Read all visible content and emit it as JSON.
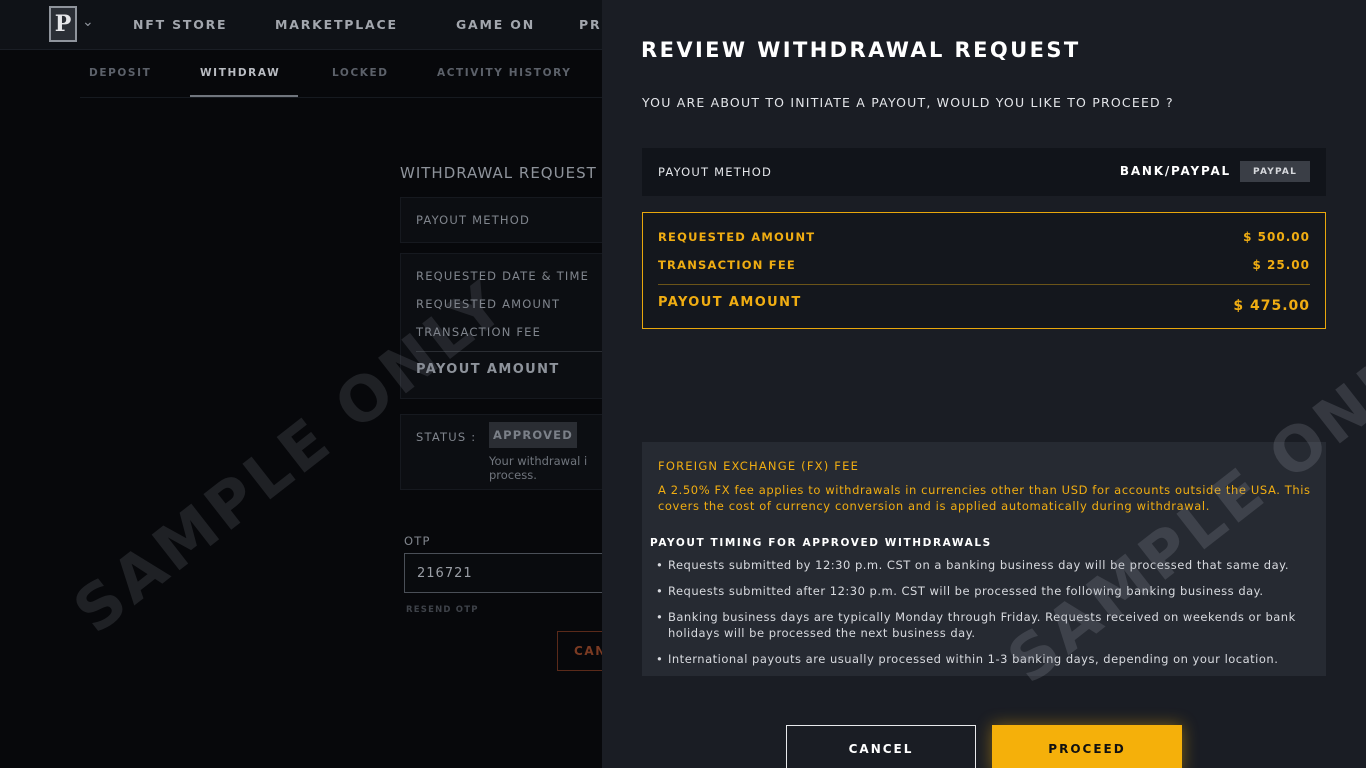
{
  "nav": {
    "items": [
      "NFT STORE",
      "MARKETPLACE",
      "GAME ON",
      "PR"
    ],
    "logo_letter": "P"
  },
  "tabs": [
    "DEPOSIT",
    "WITHDRAW",
    "LOCKED",
    "ACTIVITY HISTORY"
  ],
  "background_form": {
    "title": "WITHDRAWAL REQUEST",
    "payout_method_label": "PAYOUT METHOD",
    "requested_date_label": "REQUESTED DATE & TIME",
    "requested_amount_label": "REQUESTED AMOUNT",
    "transaction_fee_label": "TRANSACTION FEE",
    "payout_amount_label": "PAYOUT AMOUNT",
    "status_label": "STATUS :",
    "status_value": "APPROVED",
    "status_note": "Your withdrawal i process.",
    "otp_label": "OTP",
    "otp_value": "216721",
    "resend_otp": "RESEND OTP",
    "cancel_label": "CAN"
  },
  "watermark": "SAMPLE ONLY",
  "panel": {
    "title": "REVIEW WITHDRAWAL REQUEST",
    "subtitle": "YOU ARE ABOUT TO INITIATE A PAYOUT, WOULD YOU LIKE TO PROCEED ?",
    "payout_method_label": "PAYOUT METHOD",
    "payout_method_value": "BANK/PAYPAL",
    "payout_method_badge": "PAYPAL",
    "requested_amount_label": "REQUESTED AMOUNT",
    "requested_amount_value": "$ 500.00",
    "transaction_fee_label": "TRANSACTION FEE",
    "transaction_fee_value": "$ 25.00",
    "payout_amount_label": "PAYOUT AMOUNT",
    "payout_amount_value": "$ 475.00",
    "fx_title": "FOREIGN EXCHANGE (FX) FEE",
    "fx_text": "A 2.50% FX fee applies to withdrawals in currencies other than USD for accounts outside the USA. This covers the cost of currency conversion and is applied automatically during withdrawal.",
    "timing_title": "PAYOUT TIMING FOR APPROVED WITHDRAWALS",
    "timing_items": [
      "Requests submitted by 12:30 p.m. CST on a banking business day will be processed that same day.",
      "Requests submitted after 12:30 p.m. CST will be processed the following banking business day.",
      "Banking business days are typically Monday through Friday. Requests received on weekends or bank holidays will be processed the next business day.",
      "International payouts are usually processed within 1-3 banking days, depending on your location."
    ],
    "cancel_label": "CANCEL",
    "proceed_label": "PROCEED"
  },
  "colors": {
    "accent": "#f5b00a",
    "panel_bg": "#1a1d24",
    "page_bg": "#07080b"
  }
}
